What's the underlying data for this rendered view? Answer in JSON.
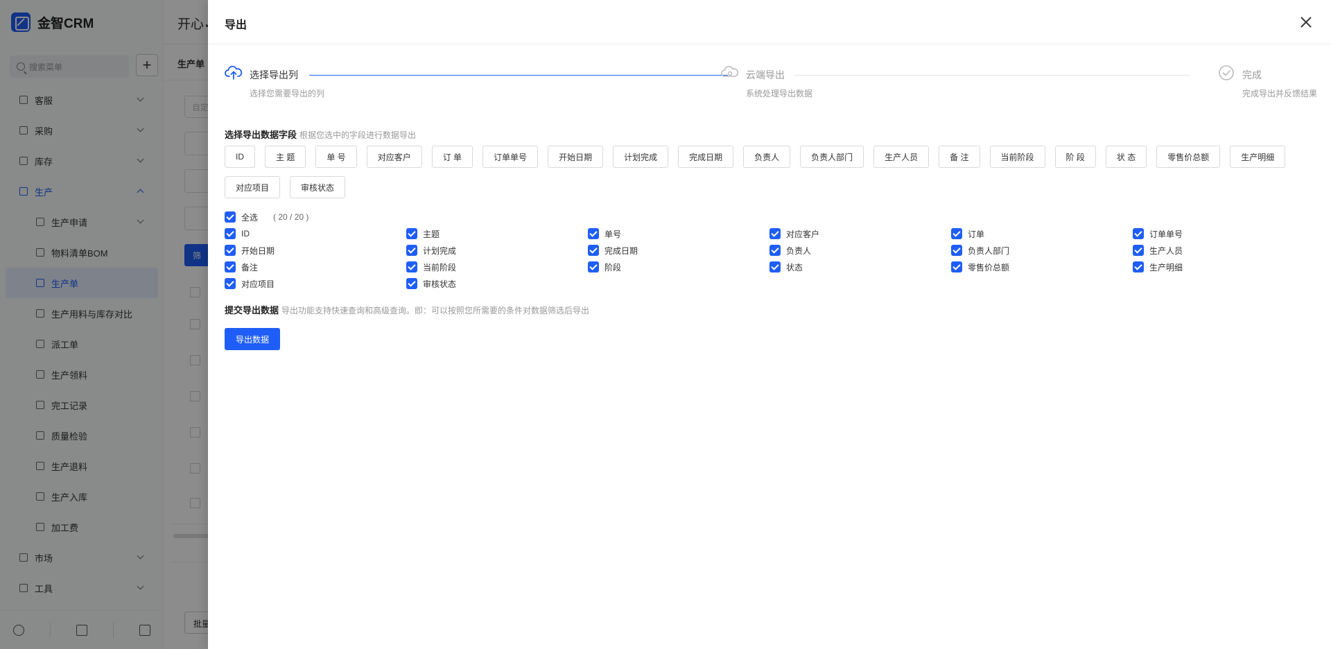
{
  "app": {
    "logo_text": "金智CRM",
    "greeting": "开心✓",
    "tab": "生产单",
    "search_placeholder": "搜索菜单",
    "input_placeholder": "自定",
    "filter_button": "筛",
    "batch_button": "批量",
    "nav": [
      {
        "label": "客服",
        "icon": "headset-icon"
      },
      {
        "label": "采购",
        "icon": "cart-icon"
      },
      {
        "label": "库存",
        "icon": "warehouse-icon"
      },
      {
        "label": "生产",
        "icon": "factory-icon"
      }
    ],
    "nav_sub": [
      {
        "label": "生产申请",
        "icon": "copy-icon"
      },
      {
        "label": "物料清单BOM",
        "icon": "list-icon"
      },
      {
        "label": "生产单",
        "icon": "factory-icon"
      },
      {
        "label": "生产用料与库存对比",
        "icon": "compare-icon"
      },
      {
        "label": "派工单",
        "icon": "dispatch-icon"
      },
      {
        "label": "生产领料",
        "icon": "document-icon"
      },
      {
        "label": "完工记录",
        "icon": "edit-document-icon"
      },
      {
        "label": "质量检验",
        "icon": "shield-check-icon"
      },
      {
        "label": "生产退料",
        "icon": "document-icon"
      },
      {
        "label": "生产入库",
        "icon": "inbox-icon"
      },
      {
        "label": "加工费",
        "icon": "money-icon"
      }
    ],
    "nav_bottom": [
      {
        "label": "市场",
        "icon": "flag-icon"
      },
      {
        "label": "工具",
        "icon": "toolbox-icon"
      }
    ]
  },
  "drawer": {
    "title": "导出",
    "steps": [
      {
        "title": "选择导出列",
        "desc": "选择您需要导出的列",
        "state": "active",
        "icon": "cloud-upload-icon"
      },
      {
        "title": "云端导出",
        "desc": "系统处理导出数据",
        "state": "wait",
        "icon": "cloud-icon"
      },
      {
        "title": "完成",
        "desc": "完成导出并反馈结果",
        "state": "wait",
        "icon": "check-circle-icon"
      }
    ],
    "fields_section": {
      "title": "选择导出数据字段",
      "hint": "根据您选中的字段进行数据导出"
    },
    "tags": [
      "ID",
      "主 题",
      "单 号",
      "对应客户",
      "订 单",
      "订单单号",
      "开始日期",
      "计划完成",
      "完成日期",
      "负责人",
      "负责人部门",
      "生产人员",
      "备 注",
      "当前阶段",
      "阶 段",
      "状 态",
      "零售价总额",
      "生产明细",
      "对应项目",
      "审核状态"
    ],
    "select_all": {
      "label": "全选",
      "count": "( 20 / 20 )"
    },
    "checkboxes": [
      "ID",
      "主题",
      "单号",
      "对应客户",
      "订单",
      "订单单号",
      "开始日期",
      "计划完成",
      "完成日期",
      "负责人",
      "负责人部门",
      "生产人员",
      "备注",
      "当前阶段",
      "阶段",
      "状态",
      "零售价总额",
      "生产明细",
      "对应项目",
      "审核状态"
    ],
    "submit_section": {
      "title": "提交导出数据",
      "hint": "导出功能支持快速查询和高级查询。即：可以按照您所需要的条件对数据筛选后导出"
    },
    "export_button": "导出数据"
  },
  "colors": {
    "primary": "#1f5ef6",
    "mask": "rgba(0,0,0,0.45)"
  }
}
